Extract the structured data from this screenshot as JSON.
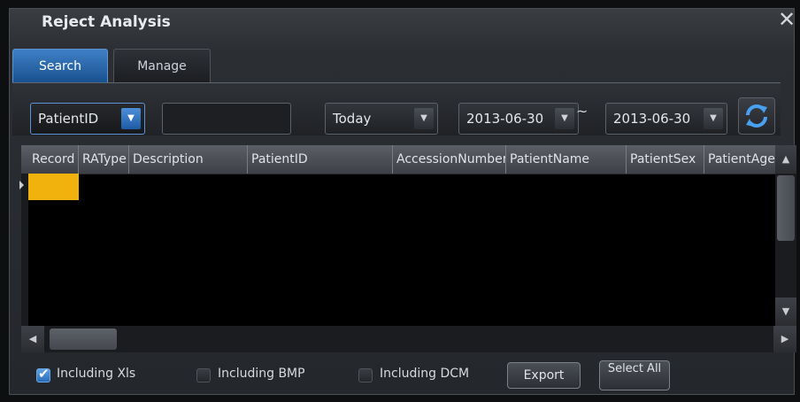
{
  "window": {
    "title": "Reject Analysis",
    "close_glyph": "✕"
  },
  "tabs": [
    {
      "label": "Search",
      "active": true
    },
    {
      "label": "Manage",
      "active": false
    }
  ],
  "filters": {
    "field": {
      "value": "PatientID"
    },
    "keyword": {
      "value": ""
    },
    "range": {
      "value": "Today"
    },
    "date_from": {
      "value": "2013-06-30"
    },
    "separator": "~",
    "date_to": {
      "value": "2013-06-30"
    },
    "refresh_icon": "refresh-icon"
  },
  "table": {
    "columns": [
      "Record",
      "RAType",
      "Description",
      "PatientID",
      "AccessionNumber",
      "PatientName",
      "PatientSex",
      "PatientAge"
    ],
    "rows": [],
    "selected_color": "#f1b20d"
  },
  "options": {
    "including_xls": {
      "label": "Including Xls",
      "checked": true
    },
    "including_bmp": {
      "label": "Including BMP",
      "checked": false
    },
    "including_dcm": {
      "label": "Including DCM",
      "checked": false
    }
  },
  "buttons": {
    "export": "Export",
    "select_all": "Select All"
  },
  "colors": {
    "accent": "#2f73c2",
    "selection": "#f1b20d"
  }
}
